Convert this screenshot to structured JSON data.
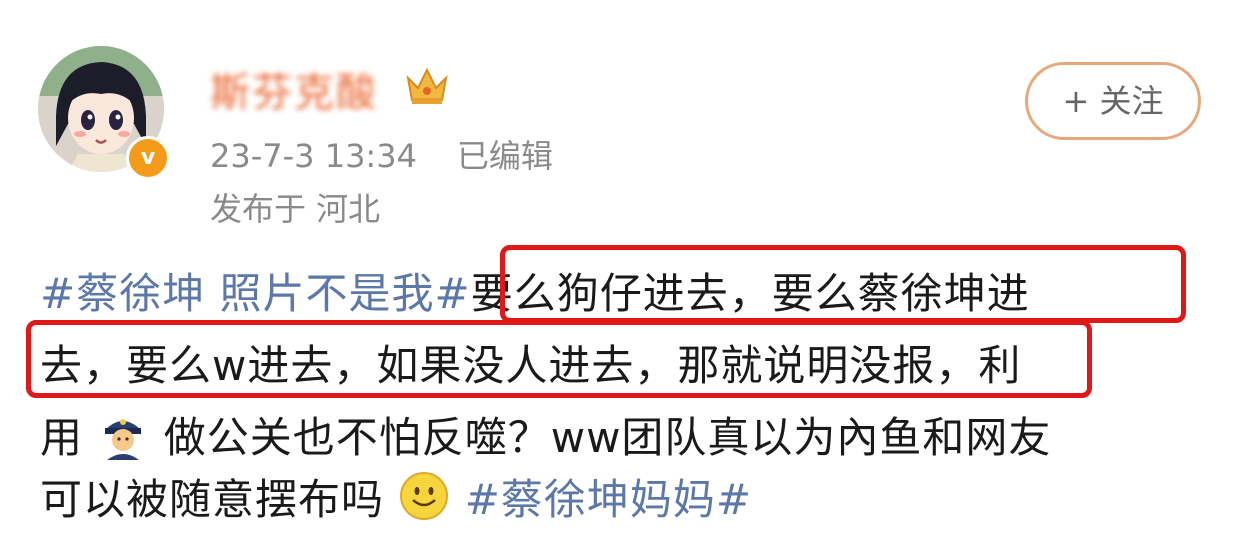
{
  "post": {
    "username": "斯芬克酸",
    "timestamp": "23-7-3 13:34",
    "edited": "已编辑",
    "location": "发布于 河北",
    "follow_label": "+ 关注",
    "verified_badge": "v",
    "icons": [
      "avatar-portrait",
      "verified-badge-icon",
      "crown-icon",
      "police-officer-emoji",
      "smiley-emoji"
    ],
    "colors": {
      "accent": "#e8642c",
      "hashtag": "#5c78a8",
      "highlight": "#e01818",
      "meta": "#8a8a8a"
    }
  },
  "content": {
    "line1_tag": "#蔡徐坤 照片不是我#",
    "line1_text": "要么狗仔进去，要么蔡徐坤进",
    "line2_text": "去，要么w进去，如果没人进去，那就说明没报，利",
    "line3_pre": "用",
    "line3_text": "做公关也不怕反噬？ww团队真以为內鱼和网友",
    "line4_text": "可以被随意摆布吗",
    "line4_tag": "#蔡徐坤妈妈#"
  }
}
